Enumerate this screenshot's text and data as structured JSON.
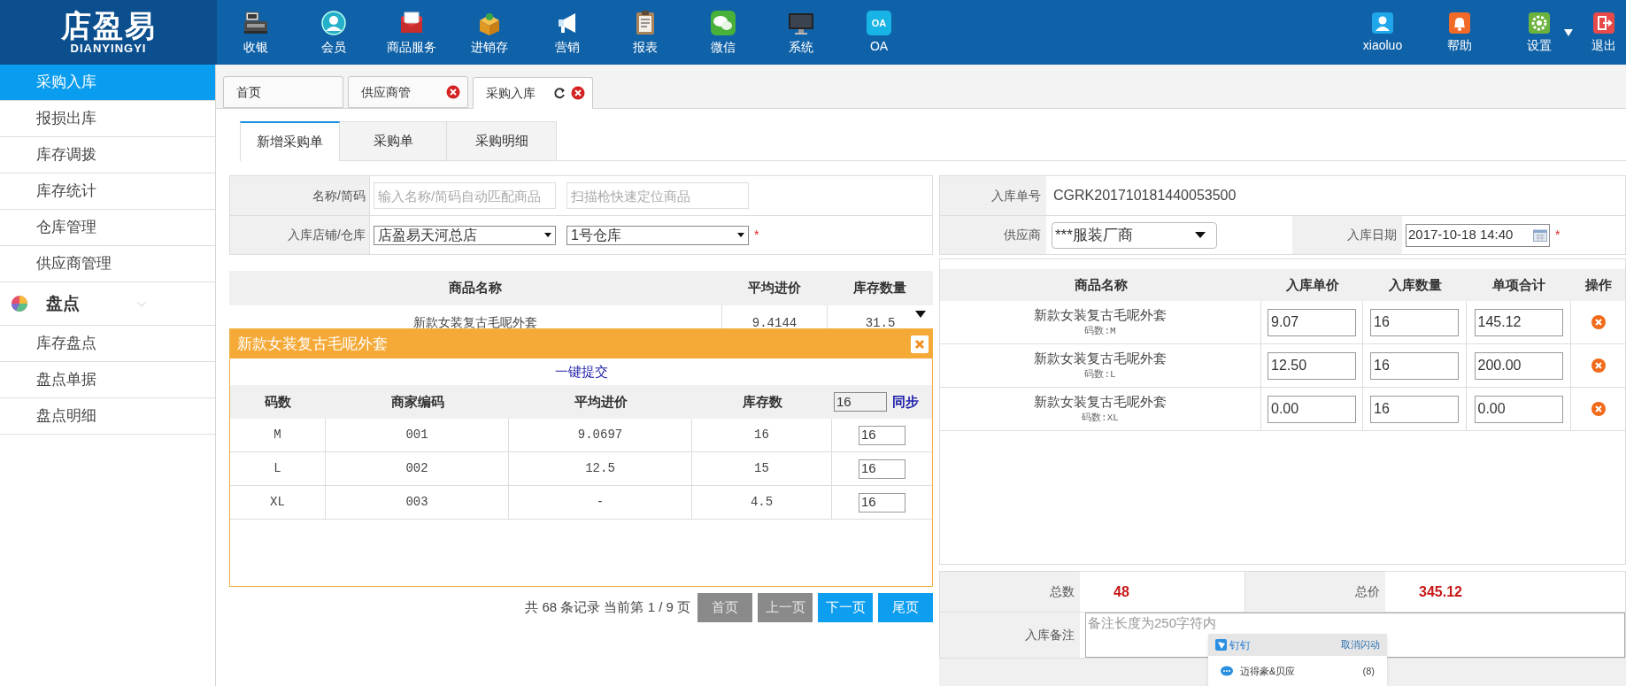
{
  "app": {
    "logo_cn": "店盈易",
    "logo_en": "DIANYINGYI"
  },
  "nav": [
    {
      "label": "收银",
      "kind": "register"
    },
    {
      "label": "会员",
      "kind": "member"
    },
    {
      "label": "商品服务",
      "kind": "service"
    },
    {
      "label": "进销存",
      "kind": "stock"
    },
    {
      "label": "营销",
      "kind": "megaphone"
    },
    {
      "label": "报表",
      "kind": "report"
    },
    {
      "label": "微信",
      "kind": "wechat"
    },
    {
      "label": "系统",
      "kind": "monitor"
    },
    {
      "label": "OA",
      "kind": "oa",
      "badge": "OA"
    }
  ],
  "user_menu": [
    {
      "label": "xiaoluo",
      "kind": "user"
    },
    {
      "label": "帮助",
      "kind": "bell"
    },
    {
      "label": "设置",
      "kind": "gear",
      "caret": true
    },
    {
      "label": "退出",
      "kind": "exit"
    }
  ],
  "sidebar": {
    "items": [
      {
        "label": "采购入库",
        "selected": true
      },
      {
        "label": "报损出库",
        "selected": false
      },
      {
        "label": "库存调拨",
        "selected": false
      },
      {
        "label": "库存统计",
        "selected": false
      },
      {
        "label": "仓库管理",
        "selected": false
      },
      {
        "label": "供应商管理",
        "selected": false
      }
    ],
    "section": {
      "label": "盘点",
      "items": [
        {
          "label": "库存盘点",
          "selected": false
        },
        {
          "label": "盘点单据",
          "selected": false
        },
        {
          "label": "盘点明细",
          "selected": false
        }
      ]
    }
  },
  "page_tabs": [
    {
      "label": "首页",
      "selected": false,
      "closable": false,
      "refreshable": false
    },
    {
      "label": "供应商管",
      "selected": false,
      "closable": true,
      "refreshable": false
    },
    {
      "label": "采购入库",
      "selected": true,
      "closable": true,
      "refreshable": true
    }
  ],
  "sub_tabs": [
    {
      "label": "新增采购单",
      "selected": true
    },
    {
      "label": "采购单",
      "selected": false
    },
    {
      "label": "采购明细",
      "selected": false
    }
  ],
  "product_search": {
    "rows": [
      {
        "label": "名称/简码",
        "fields": [
          {
            "kind": "input",
            "placeholder": "输入名称/简码自动匹配商品"
          },
          {
            "kind": "input",
            "placeholder": "扫描枪快速定位商品"
          }
        ]
      },
      {
        "label": "入库店铺/仓库",
        "required_mark": "*",
        "fields": [
          {
            "kind": "select",
            "value": "店盈易天河总店"
          },
          {
            "kind": "select",
            "value": "1号仓库"
          }
        ]
      }
    ]
  },
  "product_table": {
    "columns": [
      "商品名称",
      "平均进价",
      "库存数量"
    ],
    "rows": [
      {
        "cells": [
          "新款女装复古毛呢外套",
          "9.4144",
          "31.5"
        ]
      }
    ]
  },
  "size_popup": {
    "title": "新款女装复古毛呢外套",
    "submit_link": "一键提交",
    "columns": [
      "码数",
      "商家编码",
      "平均进价",
      "库存数"
    ],
    "batch_value": "16",
    "sync_link": "同步",
    "rows": [
      {
        "cells": [
          "M",
          "001",
          "9.0697",
          "16"
        ],
        "quantity": "16"
      },
      {
        "cells": [
          "L",
          "002",
          "12.5",
          "15"
        ],
        "quantity": "16"
      },
      {
        "cells": [
          "XL",
          "003",
          "-",
          "4.5"
        ],
        "quantity": "16"
      }
    ]
  },
  "pagination": {
    "summary": "共 68 条记录 当前第 1 / 9 页",
    "buttons": [
      {
        "label": "首页",
        "disabled": true
      },
      {
        "label": "上一页",
        "disabled": true
      },
      {
        "label": "下一页",
        "disabled": false
      },
      {
        "label": "尾页",
        "disabled": false
      }
    ]
  },
  "order": {
    "number_label": "入库单号",
    "number": "CGRK201710181440053500",
    "supplier_label": "供应商",
    "supplier": "***服装厂商",
    "date_label": "入库日期",
    "date": "2017-10-18 14:40",
    "date_required_mark": "*"
  },
  "order_table": {
    "columns": [
      "商品名称",
      "入库单价",
      "入库数量",
      "单项合计",
      "操作"
    ],
    "rows": [
      {
        "name": "新款女装复古毛呢外套",
        "size": "码数:M",
        "price": "9.07",
        "quantity": "16",
        "subtotal": "145.12"
      },
      {
        "name": "新款女装复古毛呢外套",
        "size": "码数:L",
        "price": "12.50",
        "quantity": "16",
        "subtotal": "200.00"
      },
      {
        "name": "新款女装复古毛呢外套",
        "size": "码数:XL",
        "price": "0.00",
        "quantity": "16",
        "subtotal": "0.00"
      }
    ]
  },
  "totals": {
    "count_label": "总数",
    "count": "48",
    "price_label": "总价",
    "price": "345.12"
  },
  "remarks": {
    "label": "入库备注",
    "placeholder": "备注长度为250字符内"
  },
  "notification": {
    "app": "钉钉",
    "action": "取消闪动",
    "items": [
      {
        "name": "迈得豪&贝应",
        "count": "(8)"
      }
    ]
  }
}
